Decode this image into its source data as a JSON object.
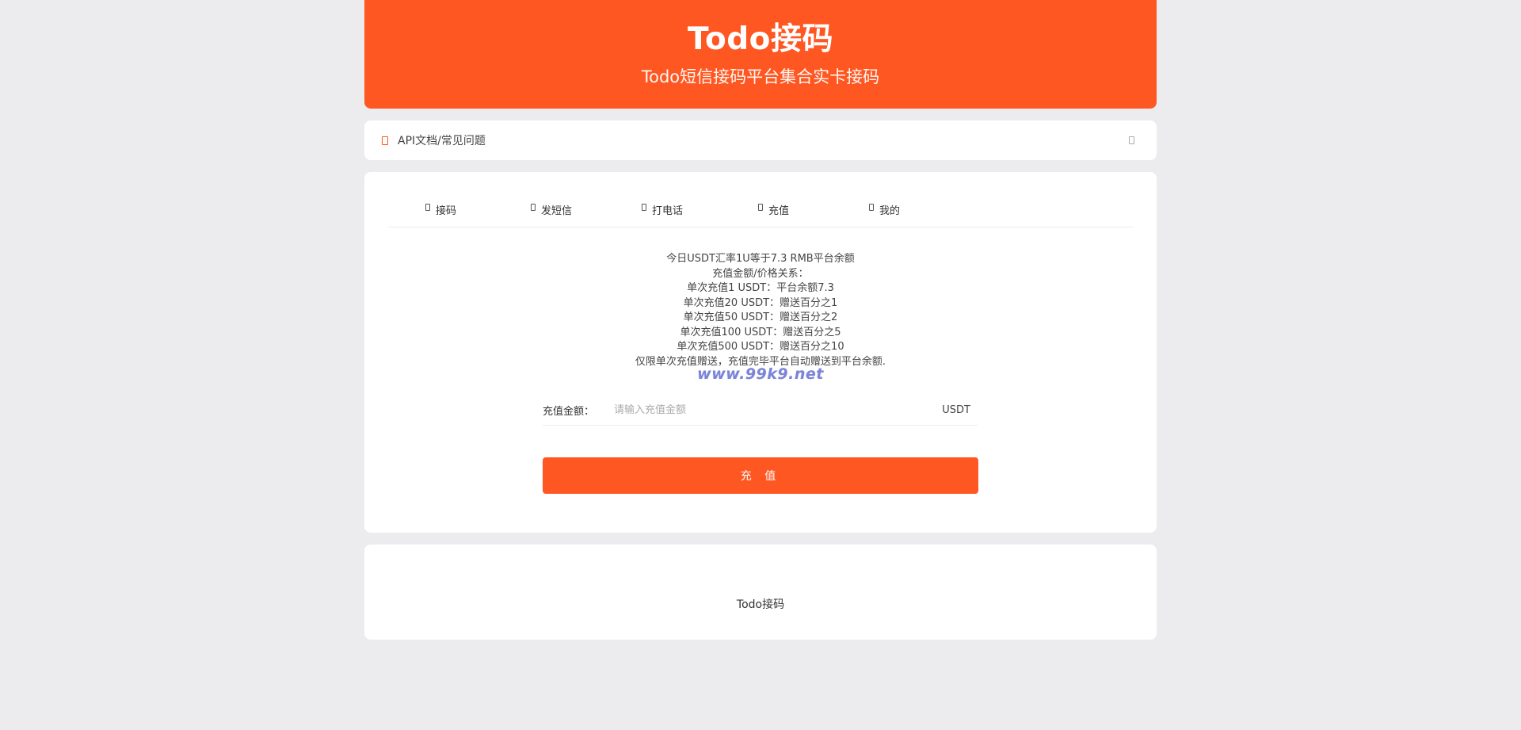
{
  "header": {
    "title": "Todo接码",
    "subtitle": "Todo短信接码平台集合实卡接码"
  },
  "notice": {
    "label": "API文档/常见问题"
  },
  "tabs": [
    {
      "label": "接码"
    },
    {
      "label": "发短信"
    },
    {
      "label": "打电话"
    },
    {
      "label": "充值"
    },
    {
      "label": "我的"
    }
  ],
  "recharge": {
    "info_lines": [
      "今日USDT汇率1U等于7.3 RMB平台余额",
      "充值金额/价格关系：",
      "单次充值1 USDT：平台余额7.3",
      "单次充值20 USDT：赠送百分之1",
      "单次充值50 USDT：赠送百分之2",
      "单次充值100 USDT：赠送百分之5",
      "单次充值500 USDT：赠送百分之10",
      "仅限单次充值赠送，充值完毕平台自动赠送到平台余额."
    ],
    "watermark": "www.99k9.net",
    "amount_label": "充值金额：",
    "amount_placeholder": "请输入充值金额",
    "amount_value": "",
    "unit": "USDT",
    "submit_label": "充 值"
  },
  "footer": {
    "text": "Todo接码"
  },
  "colors": {
    "accent": "#ff5722",
    "background": "#ececee",
    "watermark": "#7b84d6"
  }
}
